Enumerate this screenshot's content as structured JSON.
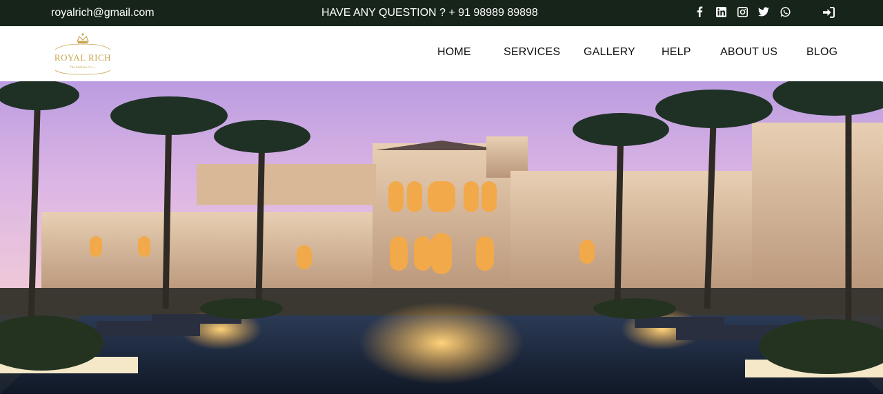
{
  "topbar": {
    "email": "royalrich@gmail.com",
    "question": "HAVE ANY QUESTION ? + 91 98989 89898",
    "socials": [
      {
        "icon": "facebook-icon"
      },
      {
        "icon": "linkedin-icon"
      },
      {
        "icon": "instagram-icon"
      },
      {
        "icon": "twitter-icon"
      },
      {
        "icon": "whatsapp-icon"
      }
    ],
    "login_icon": "sign-in-icon"
  },
  "brand": {
    "logo_text": "ROYAL RICH",
    "logo_tagline": "The Address of L...",
    "logo_color": "#c9a552"
  },
  "nav": {
    "items": [
      {
        "label": "HOME"
      },
      {
        "label": "SERVICES"
      },
      {
        "label": "GALLERY"
      },
      {
        "label": "HELP"
      },
      {
        "label": "ABOUT US"
      },
      {
        "label": "BLOG"
      }
    ]
  },
  "colors": {
    "topbar_bg": "#16241a",
    "topbar_text": "#ffffff",
    "nav_text": "#111111"
  }
}
